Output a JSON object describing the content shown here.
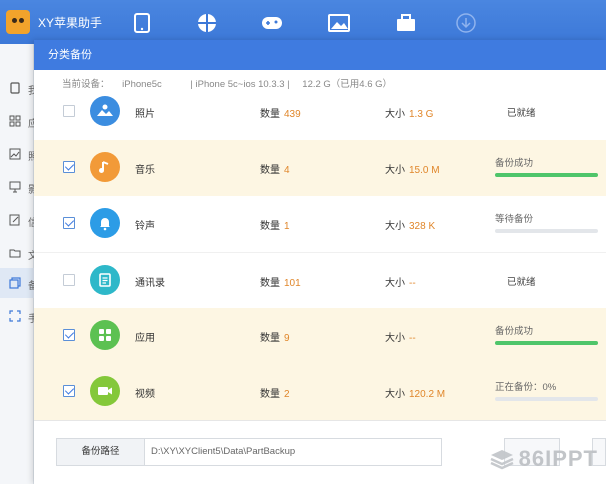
{
  "app": {
    "title": "XY苹果助手"
  },
  "topnav": [
    {
      "icon": "phone-icon"
    },
    {
      "icon": "apps-icon"
    },
    {
      "icon": "gamepad-icon"
    },
    {
      "icon": "image-icon"
    },
    {
      "icon": "toolbox-icon"
    },
    {
      "icon": "download-icon"
    }
  ],
  "sidebar": {
    "items": [
      {
        "icon": "phone-icon",
        "label": "我"
      },
      {
        "icon": "grid-icon",
        "label": "应"
      },
      {
        "icon": "chart-icon",
        "label": "照"
      },
      {
        "icon": "monitor-icon",
        "label": "影"
      },
      {
        "icon": "edit-icon",
        "label": "信"
      },
      {
        "icon": "folder-icon",
        "label": "文"
      },
      {
        "icon": "copy-icon",
        "label": "备"
      },
      {
        "icon": "scan-icon",
        "label": "手"
      }
    ]
  },
  "dialog": {
    "title": "分类备份",
    "device": {
      "label": "当前设备：",
      "name": "iPhone5c",
      "model": "| iPhone 5c~ios 10.3.3 |",
      "storage": "12.2 G（已用4.6 G）"
    },
    "count_label": "数量",
    "size_label": "大小",
    "rows": [
      {
        "name": "照片",
        "count": "439",
        "size": "1.3 G",
        "checked": false,
        "icon": "photo-icon",
        "icon_color": "#3b8de0",
        "status": "已就绪",
        "progress": null
      },
      {
        "name": "音乐",
        "count": "4",
        "size": "15.0 M",
        "checked": true,
        "icon": "music-icon",
        "icon_color": "#f29a38",
        "status": "备份成功",
        "progress": 1.0
      },
      {
        "name": "铃声",
        "count": "1",
        "size": "328 K",
        "checked": true,
        "icon": "bell-icon",
        "icon_color": "#2c9ce6",
        "status": "等待备份",
        "progress": 0.0
      },
      {
        "name": "通讯录",
        "count": "101",
        "size": "--",
        "checked": false,
        "icon": "contacts-icon",
        "icon_color": "#2eb8c9",
        "status": "已就绪",
        "progress": null
      },
      {
        "name": "应用",
        "count": "9",
        "size": "--",
        "checked": true,
        "icon": "apps-icon",
        "icon_color": "#5cc152",
        "status": "备份成功",
        "progress": 1.0
      },
      {
        "name": "视频",
        "count": "2",
        "size": "120.2 M",
        "checked": true,
        "icon": "video-icon",
        "icon_color": "#84c83a",
        "status": "正在备份：0%",
        "progress": 0.0
      }
    ],
    "footer": {
      "path_label": "备份路径",
      "path_value": "D:\\XY\\XYClient5\\Data\\PartBackup"
    }
  },
  "watermark": {
    "text": "86IPPT"
  }
}
